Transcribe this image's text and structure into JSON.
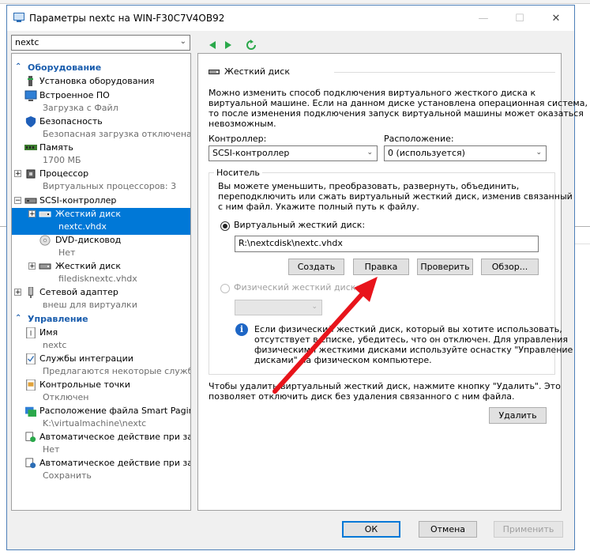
{
  "window": {
    "title": "Параметры nextc на WIN-F30C7V4OB92",
    "vm_selector": "nextc"
  },
  "sidebar": {
    "categories": [
      {
        "label": "Оборудование"
      },
      {
        "label": "Управление"
      }
    ],
    "hardware": [
      {
        "label": "Установка оборудования",
        "sub": ""
      },
      {
        "label": "Встроенное ПО",
        "sub": "Загрузка с Файл"
      },
      {
        "label": "Безопасность",
        "sub": "Безопасная загрузка отключена"
      },
      {
        "label": "Память",
        "sub": "1700 МБ"
      },
      {
        "label": "Процессор",
        "sub": "Виртуальных процессоров: 3"
      },
      {
        "label": "SCSI-контроллер",
        "sub": ""
      },
      {
        "label": "Жесткий диск",
        "sub": "nextc.vhdx"
      },
      {
        "label": "DVD-дисковод",
        "sub": "Нет"
      },
      {
        "label": "Жесткий диск",
        "sub": "filedisknextc.vhdx"
      },
      {
        "label": "Сетевой адаптер",
        "sub": "внеш для виртуалки"
      }
    ],
    "management": [
      {
        "label": "Имя",
        "sub": "nextc"
      },
      {
        "label": "Службы интеграции",
        "sub": "Предлагаются некоторые службы"
      },
      {
        "label": "Контрольные точки",
        "sub": "Отключен"
      },
      {
        "label": "Расположение файла Smart Paging",
        "sub": "K:\\virtualmachine\\nextc"
      },
      {
        "label": "Автоматическое действие при за...",
        "sub": "Нет"
      },
      {
        "label": "Автоматическое действие при за...",
        "sub": "Сохранить"
      }
    ]
  },
  "panel": {
    "heading": "Жесткий диск",
    "description": [
      "Можно изменить способ подключения виртуального жесткого диска к",
      "виртуальной машине. Если на данном диске установлена операционная система,",
      "то после изменения подключения запуск виртуальной машины может оказаться",
      "невозможным."
    ],
    "controller_label": "Контроллер:",
    "controller_value": "SCSI-контроллер",
    "location_label": "Расположение:",
    "location_value": "0 (используется)",
    "media_label": "Носитель",
    "media_desc": [
      "Вы можете уменьшить, преобразовать, развернуть, объединить,",
      "переподключить или сжать виртуальный жесткий диск, изменив связанный",
      "с ним файл. Укажите полный путь к файлу."
    ],
    "virtual_disk_label": "Виртуальный жесткий диск:",
    "virtual_disk_path": "R:\\nextcdisk\\nextc.vhdx",
    "buttons": {
      "create": "Создать",
      "edit": "Правка",
      "inspect": "Проверить",
      "browse": "Обзор..."
    },
    "physical_disk_label": "Физический жесткий диск:",
    "info_text": [
      "Если физический жесткий диск, который вы хотите использовать,",
      "отсутствует в списке, убедитесь, что он отключен. Для управления",
      "физическими жесткими дисками используйте оснастку \"Управление",
      "дисками\" на физическом компьютере."
    ],
    "remove_text": [
      "Чтобы удалить виртуальный жесткий диск, нажмите кнопку \"Удалить\". Это",
      "позволяет отключить диск без удаления связанного с ним файла."
    ],
    "remove_button": "Удалить"
  },
  "footer": {
    "ok": "ОК",
    "cancel": "Отмена",
    "apply": "Применить"
  },
  "colors": {
    "selection": "#0078d7",
    "category": "#1a5dad",
    "arrow": "#e8141b"
  }
}
